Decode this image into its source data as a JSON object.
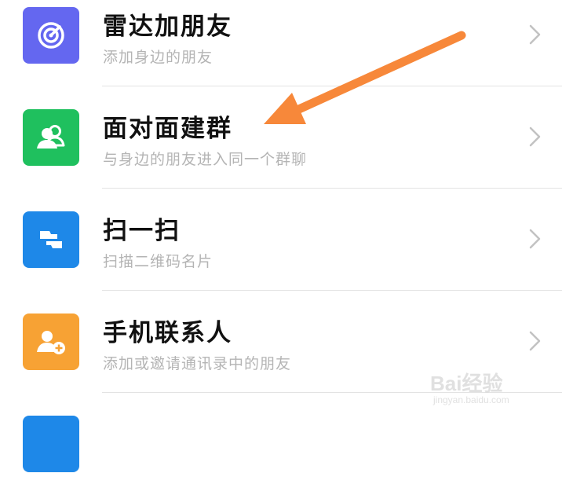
{
  "items": [
    {
      "title": "雷达加朋友",
      "subtitle": "添加身边的朋友",
      "icon": "radar-icon",
      "icon_color": "#6467f0"
    },
    {
      "title": "面对面建群",
      "subtitle": "与身边的朋友进入同一个群聊",
      "icon": "group-icon",
      "icon_color": "#1fc05e"
    },
    {
      "title": "扫一扫",
      "subtitle": "扫描二维码名片",
      "icon": "scan-icon",
      "icon_color": "#1e88e8"
    },
    {
      "title": "手机联系人",
      "subtitle": "添加或邀请通讯录中的朋友",
      "icon": "add-contact-icon",
      "icon_color": "#f7a234"
    },
    {
      "title": "",
      "subtitle": "",
      "icon": "partial-icon",
      "icon_color": "#1e88e8"
    }
  ],
  "annotation": {
    "arrow_color": "#f7883a",
    "points_to": "面对面建群"
  },
  "watermark": {
    "logo": "Bai经验",
    "url": "jingyan.baidu.com"
  }
}
